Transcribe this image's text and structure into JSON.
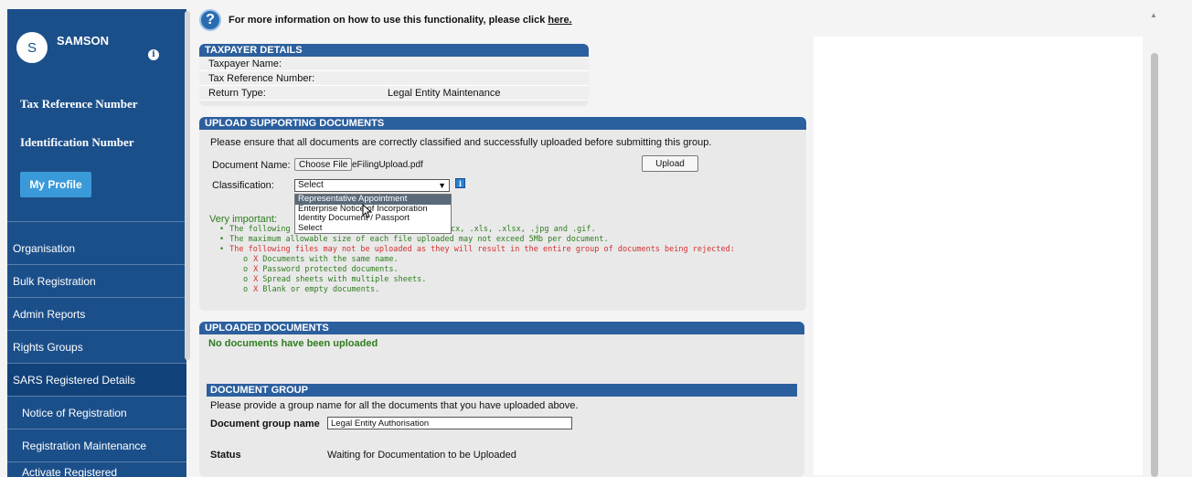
{
  "sidebar": {
    "avatar_initial": "S",
    "user_name": "SAMSON",
    "info_glyph": "i",
    "tax_reference_label": "Tax Reference Number",
    "identification_label": "Identification Number",
    "my_profile_button": "My Profile",
    "menu": [
      {
        "label": "Organisation"
      },
      {
        "label": "Bulk Registration"
      },
      {
        "label": "Admin Reports"
      },
      {
        "label": "Rights Groups"
      },
      {
        "label": "SARS Registered Details"
      },
      {
        "label": "Notice of Registration"
      },
      {
        "label": "Registration Maintenance"
      },
      {
        "label": "Activate Registered"
      }
    ]
  },
  "help": {
    "icon": "?",
    "text": "For more information on how to use this functionality, please click",
    "link": "here."
  },
  "taxpayer": {
    "heading": "TAXPAYER DETAILS",
    "rows": [
      {
        "label": "Taxpayer Name:",
        "value": ""
      },
      {
        "label": "Tax Reference Number:",
        "value": ""
      },
      {
        "label": "Return Type:",
        "value": "Legal Entity Maintenance"
      }
    ]
  },
  "upload": {
    "heading": "UPLOAD SUPPORTING DOCUMENTS",
    "instruction": "Please ensure that all documents are correctly classified and successfully uploaded before submitting this group.",
    "document_name_label": "Document Name:",
    "choose_file_button": "Choose File",
    "file_name": "eFilingUpload.pdf",
    "upload_button": "Upload",
    "classification_label": "Classification:",
    "classification_value": "Select",
    "classification_info": "i",
    "dropdown_options": [
      "Representative Appointment",
      "Enterprise Notice of Incorporation",
      "Identity Document / Passport",
      "Select"
    ],
    "very_important_label": "Very important:",
    "bullet_1_visible": "The following",
    "bullet_1_tail": ".docx, .xls, .xlsx, .jpg and .gif.",
    "bullet_2": "The maximum allowable size of each file uploaded may not exceed 5Mb per document.",
    "bullet_3": "The following files may not be uploaded as they will result in the entire group of documents being rejected:",
    "rejected": [
      "Documents with the same name.",
      "Password protected documents.",
      "Spread sheets with multiple sheets.",
      "Blank or empty documents."
    ],
    "x_mark": "X"
  },
  "uploaded": {
    "heading": "UPLOADED DOCUMENTS",
    "empty_message": "No documents have been uploaded"
  },
  "document_group": {
    "heading": "DOCUMENT GROUP",
    "instruction": "Please provide a group name for all the documents that you have uploaded above.",
    "name_label": "Document group name",
    "name_value": "Legal Entity Authorisation",
    "status_label": "Status",
    "status_value": "Waiting for Documentation to be Uploaded"
  },
  "colors": {
    "sidebar": "#1b4f8a",
    "panel_header": "#2c5f9e",
    "success_green": "#2e7d1e",
    "error_red": "#d32f2f"
  }
}
